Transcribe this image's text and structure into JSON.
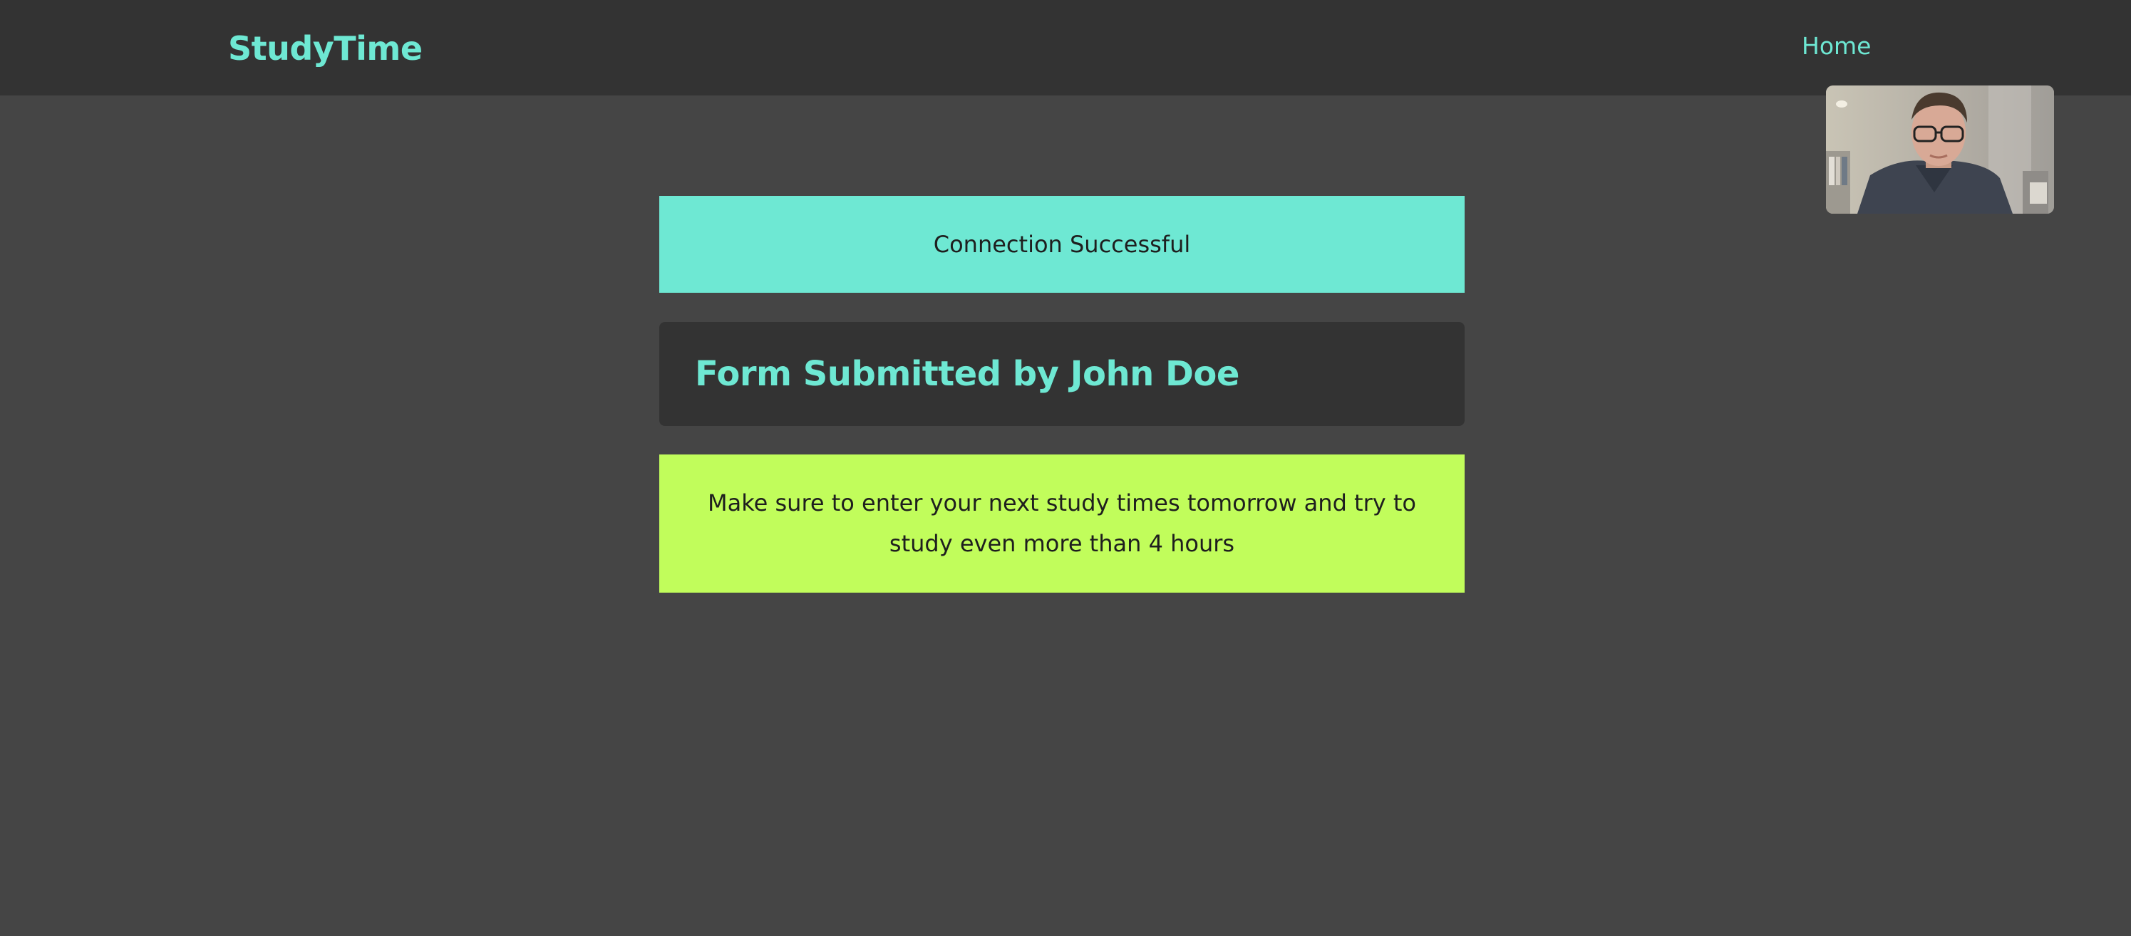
{
  "header": {
    "brand": "StudyTime",
    "nav": {
      "home_label": "Home"
    }
  },
  "video_feed": {
    "icon": "webcam-preview"
  },
  "alerts": {
    "connection": "Connection Successful"
  },
  "submission": {
    "title": "Form Submitted by John Doe"
  },
  "reminder": {
    "message": "Make sure to enter your next study times tomorrow and try to study even more than 4 hours"
  },
  "colors": {
    "background": "#454545",
    "header_bg": "#333333",
    "accent_teal": "#6ee8d3",
    "accent_lime": "#c1fd5b",
    "text_dark": "#1e1e1e"
  }
}
